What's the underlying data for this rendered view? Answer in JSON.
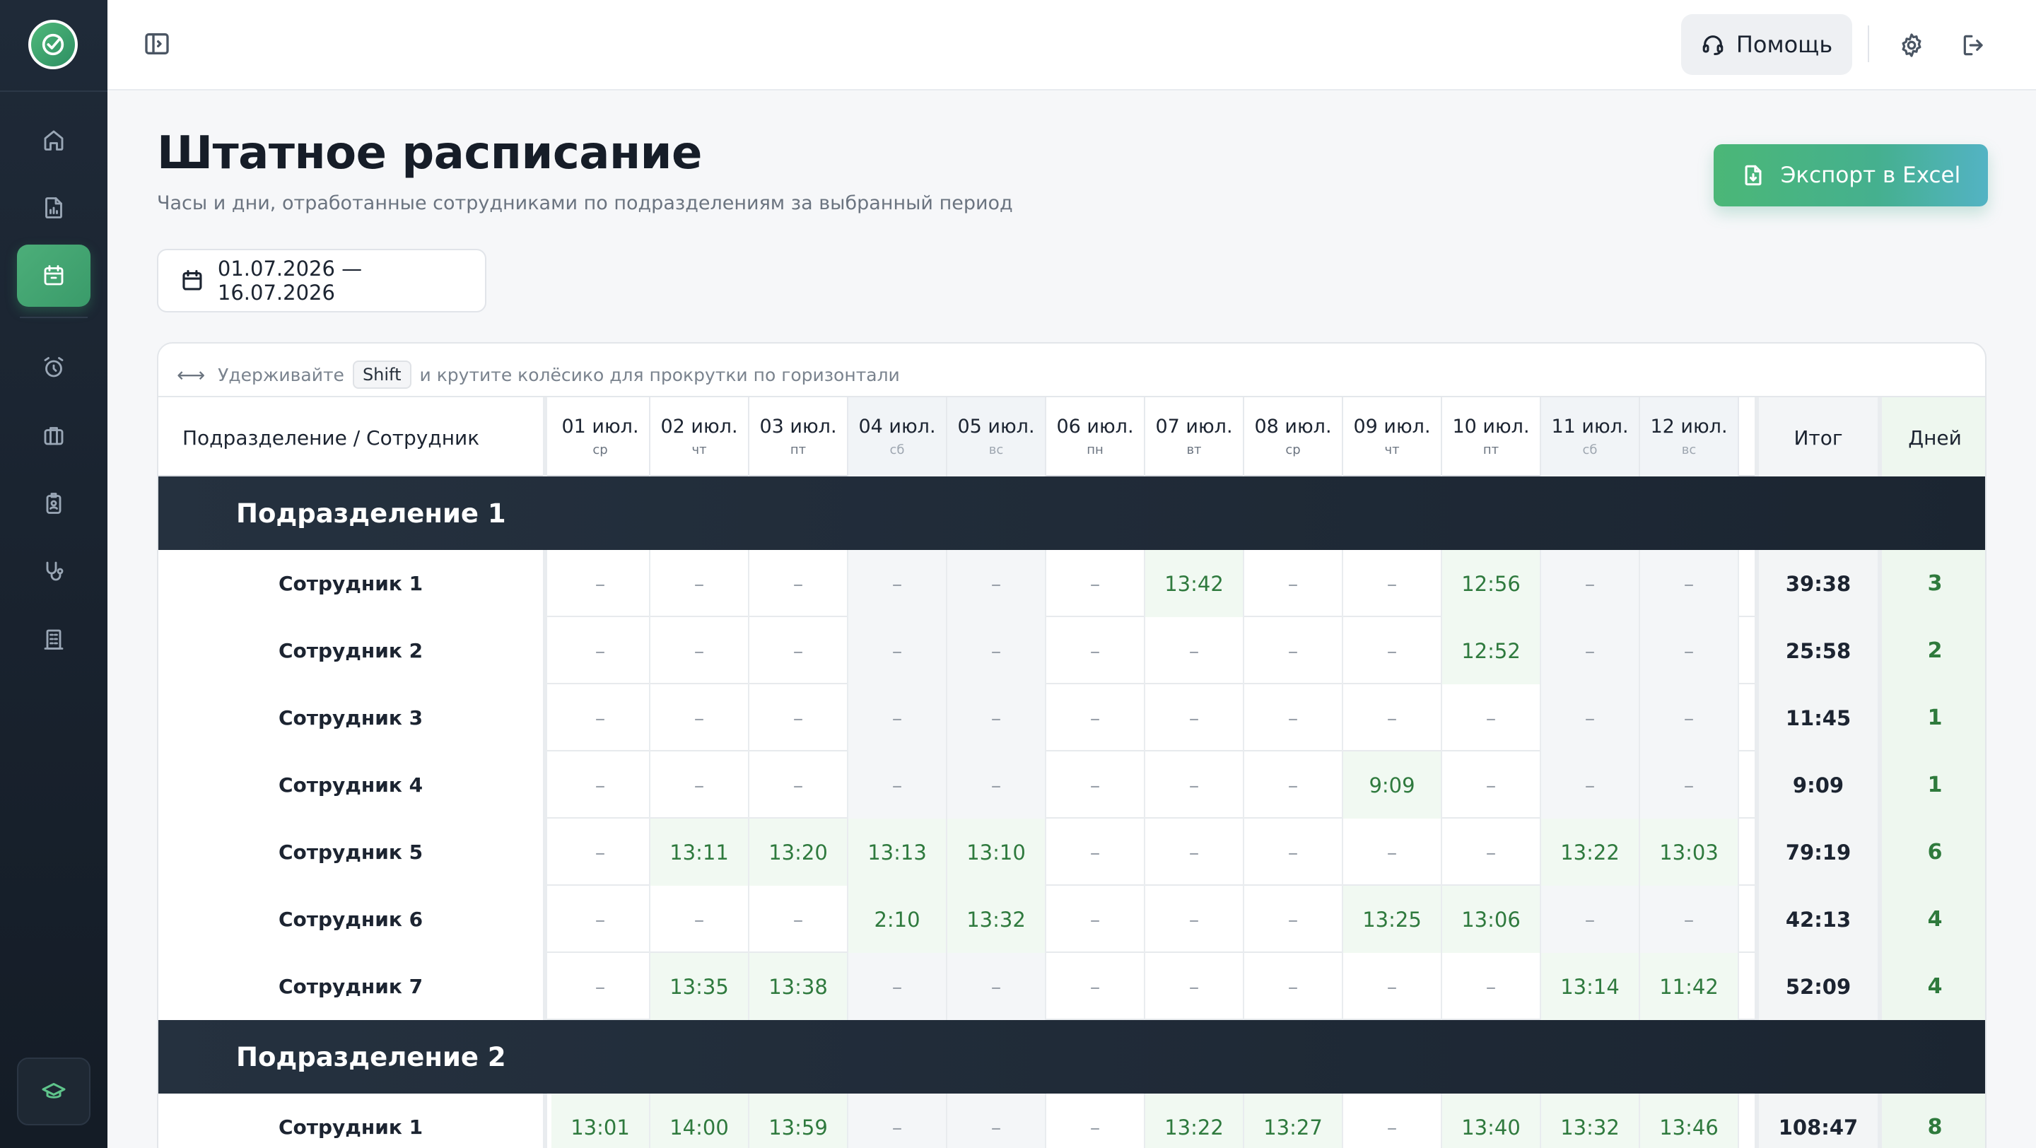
{
  "sidebar": {
    "items": [
      {
        "name": "home-icon"
      },
      {
        "name": "report-icon"
      },
      {
        "name": "calendar-icon",
        "active": true
      },
      {
        "name": "alarm-icon"
      },
      {
        "name": "briefcase-icon"
      },
      {
        "name": "badge-icon"
      },
      {
        "name": "stethoscope-icon"
      },
      {
        "name": "building-icon"
      }
    ],
    "bottom_icon": "graduation-cap-icon"
  },
  "topbar": {
    "help_label": "Помощь"
  },
  "page": {
    "title": "Штатное расписание",
    "subtitle": "Часы и дни, отработанные сотрудниками по подразделениям за выбранный период",
    "export_label": "Экспорт в Excel",
    "date_range": "01.07.2026 — 16.07.2026"
  },
  "hint": {
    "before": "Удерживайте",
    "key": "Shift",
    "after": "и крутите колёсико для прокрутки по горизонтали"
  },
  "table": {
    "name_header": "Подразделение / Сотрудник",
    "total_header": "Итог",
    "days_header": "Дней",
    "columns": [
      {
        "date": "01 июл.",
        "dow": "ср",
        "weekend": false
      },
      {
        "date": "02 июл.",
        "dow": "чт",
        "weekend": false
      },
      {
        "date": "03 июл.",
        "dow": "пт",
        "weekend": false
      },
      {
        "date": "04 июл.",
        "dow": "сб",
        "weekend": true
      },
      {
        "date": "05 июл.",
        "dow": "вс",
        "weekend": true
      },
      {
        "date": "06 июл.",
        "dow": "пн",
        "weekend": false
      },
      {
        "date": "07 июл.",
        "dow": "вт",
        "weekend": false
      },
      {
        "date": "08 июл.",
        "dow": "ср",
        "weekend": false
      },
      {
        "date": "09 июл.",
        "dow": "чт",
        "weekend": false
      },
      {
        "date": "10 июл.",
        "dow": "пт",
        "weekend": false
      },
      {
        "date": "11 июл.",
        "dow": "сб",
        "weekend": true
      },
      {
        "date": "12 июл.",
        "dow": "вс",
        "weekend": true
      }
    ],
    "departments": [
      {
        "name": "Подразделение 1",
        "employees": [
          {
            "name": "Сотрудник 1",
            "cells": [
              "–",
              "–",
              "–",
              "–",
              "–",
              "–",
              "13:42",
              "–",
              "–",
              "12:56",
              "–",
              "–"
            ],
            "total": "39:38",
            "days": "3"
          },
          {
            "name": "Сотрудник 2",
            "cells": [
              "–",
              "–",
              "–",
              "–",
              "–",
              "–",
              "–",
              "–",
              "–",
              "12:52",
              "–",
              "–"
            ],
            "total": "25:58",
            "days": "2"
          },
          {
            "name": "Сотрудник 3",
            "cells": [
              "–",
              "–",
              "–",
              "–",
              "–",
              "–",
              "–",
              "–",
              "–",
              "–",
              "–",
              "–"
            ],
            "total": "11:45",
            "days": "1"
          },
          {
            "name": "Сотрудник 4",
            "cells": [
              "–",
              "–",
              "–",
              "–",
              "–",
              "–",
              "–",
              "–",
              "9:09",
              "–",
              "–",
              "–"
            ],
            "total": "9:09",
            "days": "1"
          },
          {
            "name": "Сотрудник 5",
            "cells": [
              "–",
              "13:11",
              "13:20",
              "13:13",
              "13:10",
              "–",
              "–",
              "–",
              "–",
              "–",
              "13:22",
              "13:03"
            ],
            "total": "79:19",
            "days": "6"
          },
          {
            "name": "Сотрудник 6",
            "cells": [
              "–",
              "–",
              "–",
              "2:10",
              "13:32",
              "–",
              "–",
              "–",
              "13:25",
              "13:06",
              "–",
              "–"
            ],
            "total": "42:13",
            "days": "4"
          },
          {
            "name": "Сотрудник 7",
            "cells": [
              "–",
              "13:35",
              "13:38",
              "–",
              "–",
              "–",
              "–",
              "–",
              "–",
              "–",
              "13:14",
              "11:42"
            ],
            "total": "52:09",
            "days": "4"
          }
        ]
      },
      {
        "name": "Подразделение 2",
        "employees": [
          {
            "name": "Сотрудник 1",
            "cells": [
              "13:01",
              "14:00",
              "13:59",
              "–",
              "–",
              "–",
              "13:22",
              "13:27",
              "–",
              "13:40",
              "13:32",
              "13:46"
            ],
            "total": "108:47",
            "days": "8"
          }
        ]
      }
    ]
  },
  "colors": {
    "accent": "#4cae79",
    "sidebar_bg": "#1a2330",
    "department_bg": "#1f2a37",
    "worked_cell_bg": "#f1f9f2",
    "worked_text": "#2f7a3e"
  }
}
